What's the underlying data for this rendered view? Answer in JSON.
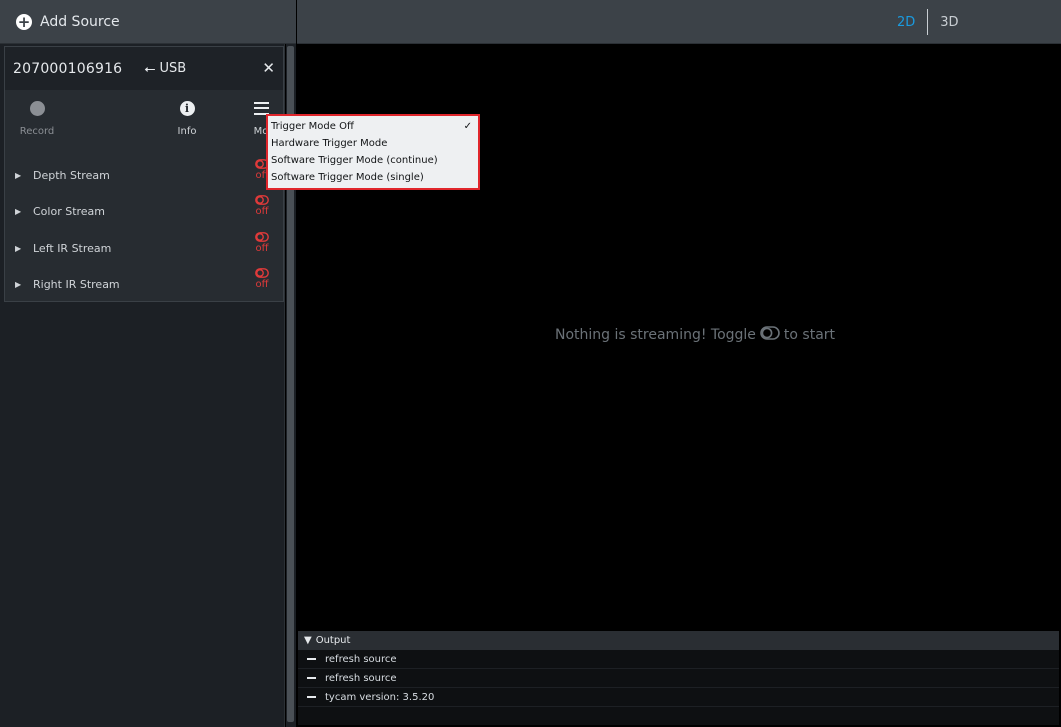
{
  "header": {
    "add_source_label": "Add Source",
    "view_2d": "2D",
    "view_3d": "3D"
  },
  "device": {
    "serial": "207000106916",
    "connection": "USB",
    "tools": {
      "record": "Record",
      "info": "Info",
      "mode": "Mo"
    },
    "streams": [
      {
        "label": "Depth Stream",
        "state": "off"
      },
      {
        "label": "Color Stream",
        "state": "off"
      },
      {
        "label": "Left IR Stream",
        "state": "off"
      },
      {
        "label": "Right IR Stream",
        "state": "off"
      }
    ]
  },
  "trigger_menu": {
    "items": [
      {
        "label": "Trigger Mode Off",
        "checked": true
      },
      {
        "label": "Hardware Trigger Mode",
        "checked": false
      },
      {
        "label": "Software Trigger Mode (continue)",
        "checked": false
      },
      {
        "label": "Software Trigger Mode (single)",
        "checked": false
      }
    ],
    "check_mark": "✓"
  },
  "viewer": {
    "empty_prefix": "Nothing is streaming! Toggle",
    "empty_suffix": "to start"
  },
  "output": {
    "title": "Output",
    "lines": [
      "refresh source",
      "refresh source",
      "tycam version: 3.5.20"
    ]
  },
  "colors": {
    "accent_blue": "#1a9be0",
    "off_red": "#e03a3a",
    "highlight_border": "#e0262c",
    "topbar": "#3c4248",
    "sidebar": "#1c2025"
  },
  "icons": {
    "add": "plus-circle-icon",
    "usb": "usb-icon",
    "close": "close-icon",
    "record": "record-dot-icon",
    "info": "info-icon",
    "menu": "hamburger-menu-icon",
    "expand": "caret-right-icon",
    "toggle": "toggle-icon",
    "collapse": "caret-down-icon",
    "log": "dash-icon"
  }
}
